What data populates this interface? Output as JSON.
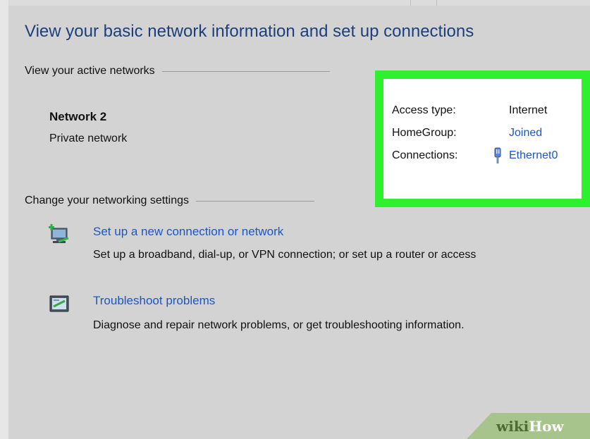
{
  "page": {
    "title": "View your basic network information and set up connections"
  },
  "active_networks": {
    "heading": "View your active networks",
    "network_name": "Network  2",
    "network_type": "Private network",
    "details": {
      "access_type_label": "Access type:",
      "access_type_value": "Internet",
      "homegroup_label": "HomeGroup:",
      "homegroup_value": "Joined",
      "connections_label": "Connections:",
      "connections_value": "Ethernet0"
    }
  },
  "settings": {
    "heading": "Change your networking settings",
    "tasks": [
      {
        "link": "Set up a new connection or network",
        "description": "Set up a broadband, dial-up, or VPN connection; or set up a router or access",
        "icon": "new-connection-icon"
      },
      {
        "link": "Troubleshoot problems",
        "description": "Diagnose and repair network problems, or get troubleshooting information.",
        "icon": "troubleshoot-icon"
      }
    ]
  },
  "watermark": {
    "part1": "wiki",
    "part2": "How"
  },
  "colors": {
    "highlight": "#2ef02e",
    "link": "#1a56c8",
    "title": "#1e3f7a",
    "background": "#d3d3d3"
  }
}
